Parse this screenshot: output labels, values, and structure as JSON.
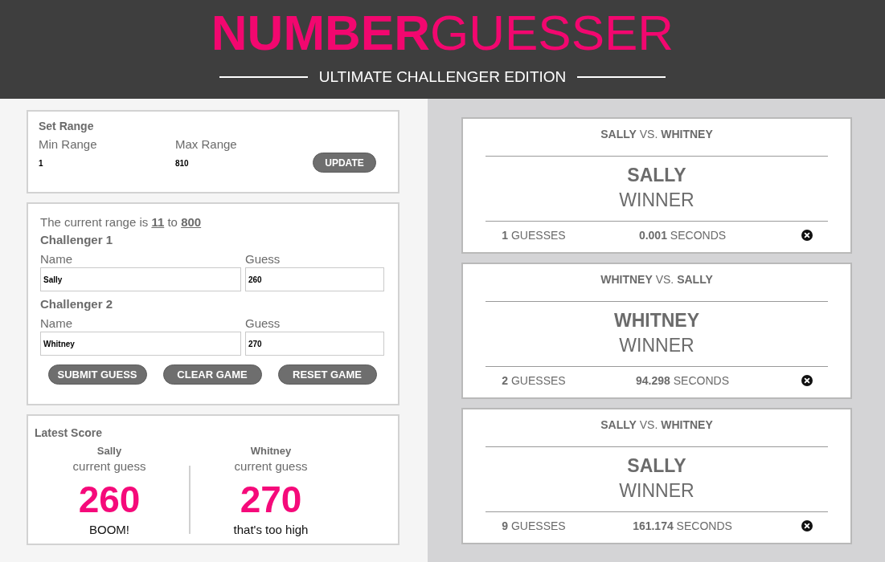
{
  "header": {
    "title": "**NUMBER**GUESSER",
    "subtitle": "ULTIMATE CHALLENGER EDITION"
  },
  "set_range": {
    "title": "Set Range",
    "fields": [
      {
        "label": "Min Range",
        "value": "1"
      },
      {
        "label": "Max Range",
        "value": "810"
      }
    ],
    "button": "UPDATE"
  },
  "game": {
    "range_text": "The current range is **11** to **800**",
    "challengers": [
      {
        "title": "Challenger 1",
        "fields": [
          {
            "label": "Name",
            "value": "Sally"
          },
          {
            "label": "Guess",
            "value": "260"
          }
        ]
      },
      {
        "title": "Challenger 2",
        "fields": [
          {
            "label": "Name",
            "value": "Whitney"
          },
          {
            "label": "Guess",
            "value": "270"
          }
        ]
      }
    ],
    "buttons": [
      "SUBMIT GUESS",
      "CLEAR GAME",
      "RESET GAME"
    ]
  },
  "latest_score": {
    "title": "Latest Score",
    "players": [
      {
        "name": "Sally",
        "caption": "current guess",
        "guess": "260",
        "feedback": "BOOM!"
      },
      {
        "name": "Whitney",
        "caption": "current guess",
        "guess": "270",
        "feedback": "that's too high"
      }
    ]
  },
  "results": [
    {
      "matchup": "**SALLY** VS. **WHITNEY**",
      "winner": "SALLY",
      "winner_label": "WINNER",
      "guesses": "**1** GUESSES",
      "time": "**0.001** SECONDS"
    },
    {
      "matchup": "**WHITNEY** VS. **SALLY**",
      "winner": "WHITNEY",
      "winner_label": "WINNER",
      "guesses": "**2** GUESSES",
      "time": "**94.298** SECONDS"
    },
    {
      "matchup": "**SALLY** VS. **WHITNEY**",
      "winner": "SALLY",
      "winner_label": "WINNER",
      "guesses": "**9** GUESSES",
      "time": "**161.174** SECONDS"
    }
  ]
}
